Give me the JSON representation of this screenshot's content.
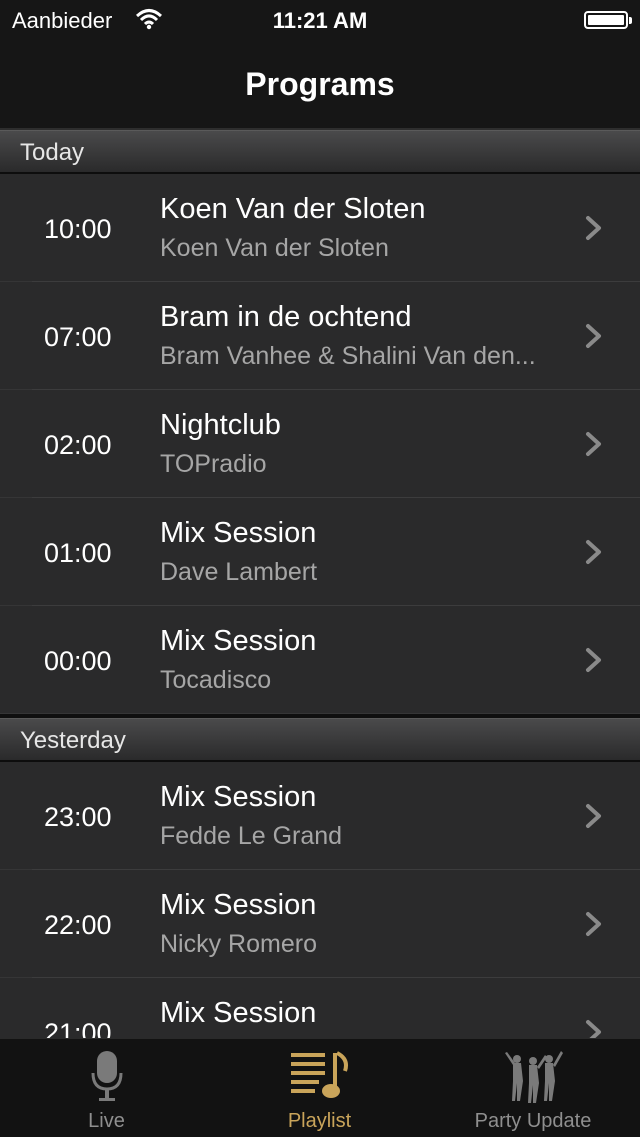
{
  "status_bar": {
    "carrier": "Aanbieder",
    "time": "11:21 AM"
  },
  "nav": {
    "title": "Programs"
  },
  "sections": [
    {
      "header": "Today",
      "rows": [
        {
          "time": "10:00",
          "title": "Koen Van der Sloten",
          "subtitle": "Koen Van der Sloten"
        },
        {
          "time": "07:00",
          "title": "Bram in de ochtend",
          "subtitle": "Bram Vanhee & Shalini Van den..."
        },
        {
          "time": "02:00",
          "title": "Nightclub",
          "subtitle": "TOPradio"
        },
        {
          "time": "01:00",
          "title": "Mix Session",
          "subtitle": "Dave Lambert"
        },
        {
          "time": "00:00",
          "title": "Mix Session",
          "subtitle": "Tocadisco"
        }
      ]
    },
    {
      "header": "Yesterday",
      "rows": [
        {
          "time": "23:00",
          "title": "Mix Session",
          "subtitle": "Fedde Le Grand"
        },
        {
          "time": "22:00",
          "title": "Mix Session",
          "subtitle": "Nicky Romero"
        },
        {
          "time": "21:00",
          "title": "Mix Session",
          "subtitle": ""
        }
      ]
    }
  ],
  "tab_bar": {
    "tabs": [
      {
        "label": "Live",
        "icon": "microphone-icon",
        "active": false
      },
      {
        "label": "Playlist",
        "icon": "playlist-music-note-icon",
        "active": true
      },
      {
        "label": "Party Update",
        "icon": "dancing-people-icon",
        "active": false
      }
    ]
  },
  "colors": {
    "accent": "#c9a45a",
    "background": "#2a2a2b",
    "subtitle": "#a6a6a6"
  }
}
